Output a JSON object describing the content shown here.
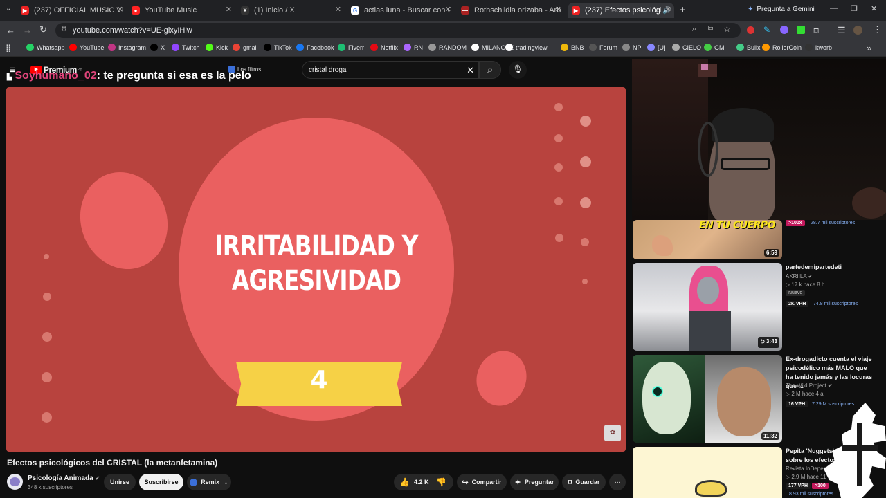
{
  "tabs": [
    {
      "title": "(237) OFFICIAL MUSIC VIDEO: S",
      "color": "#e22"
    },
    {
      "title": "YouTube Music",
      "color": "#f22"
    },
    {
      "title": "(1) Inicio / X",
      "color": "#222"
    },
    {
      "title": "actias luna - Buscar con Google",
      "color": "#fff"
    },
    {
      "title": "Rothschildia orizaba - Arboretu",
      "color": "#a22"
    },
    {
      "title": "(237) Efectos psicológicos d",
      "color": "#e22"
    }
  ],
  "gemini_label": "Pregunta a Gemini",
  "url": "youtube.com/watch?v=UE-glxyIHlw",
  "bookmarks": [
    "Whatsapp",
    "YouTube",
    "Instagram",
    "X",
    "Twitch",
    "Kick",
    "gmail",
    "TikTok",
    "Facebook",
    "Fiverr",
    "Netflix",
    "RN",
    "RANDOM",
    "MILANOTE",
    "tradingview",
    "BNB",
    "Forum",
    "NP",
    "[U]",
    "CIELO",
    "GM",
    "Bullx",
    "RollerCoin",
    "kworb"
  ],
  "youtube": {
    "logo": "Premium",
    "country": "PY",
    "search_value": "cristal droga",
    "filters_label": "Los filtros"
  },
  "chat_overlay": {
    "user": "Soyhumano_02",
    "message": ": te pregunta si esa es la pelo"
  },
  "slide": {
    "title_line1": "IRRITABILIDAD Y",
    "title_line2": "AGRESIVIDAD",
    "number": "4"
  },
  "video": {
    "title": "Efectos psicológicos del CRISTAL (la metanfetamina)",
    "channel": "Psicología Animada",
    "subscribers": "348 k suscriptores",
    "join": "Unirse",
    "subscribe": "Suscribirse",
    "remix": "Remix",
    "likes": "4.2 K",
    "share": "Compartir",
    "ask": "Preguntar",
    "save": "Guardar"
  },
  "recs": [
    {
      "thumb_text": "EN TU CUERPO",
      "duration": "6:59",
      "badge": ">100x",
      "subs": "28.7 mil suscriptores"
    },
    {
      "title": "partedemipartedeti",
      "channel": "AKRIILA",
      "meta": "17 k  hace 8 h",
      "new": "Nuevo",
      "duration": "3:43",
      "vph": "2K VPH",
      "subs": "74.8 mil suscriptores"
    },
    {
      "title": "Ex-drogadicto cuenta el viaje psicodélico más MALO que ha tenido jamás y las locuras que ...",
      "channel": "The Wild Project",
      "meta": "2 M  hace 4 a",
      "duration": "11:32",
      "vph": "16 VPH",
      "subs": "7.29 M suscriptores"
    },
    {
      "title": "Pepita 'Nuggets' Animación sobre los efectos de l...",
      "channel": "Revista InDependientes. Ac",
      "meta": "2.9 M  hace 11",
      "vph": "177 VPH",
      "badge": ">100",
      "subs": "8.93 mil suscriptores"
    }
  ],
  "colors": {
    "slide_bg": "#b8433e",
    "blob": "#ea6060",
    "ribbon": "#f6d146",
    "chat_user": "#e0457b"
  }
}
